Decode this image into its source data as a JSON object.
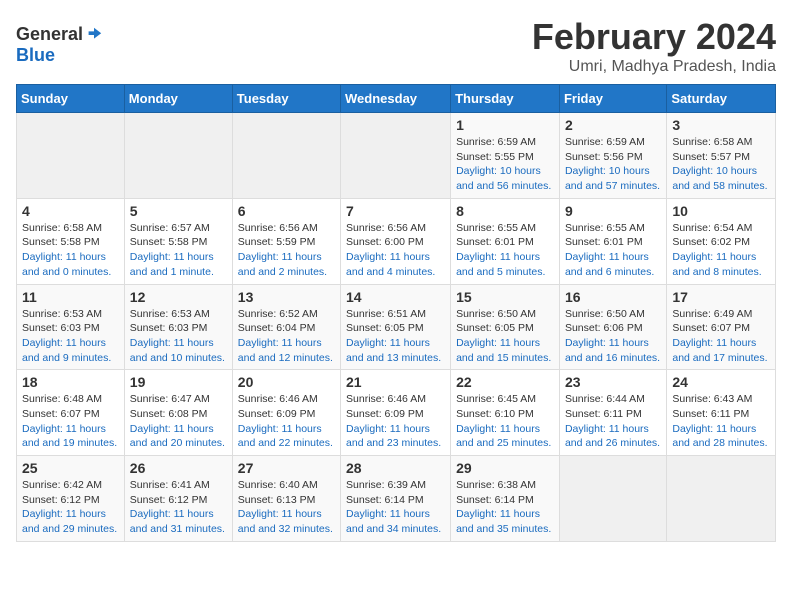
{
  "logo": {
    "general": "General",
    "blue": "Blue"
  },
  "title": "February 2024",
  "location": "Umri, Madhya Pradesh, India",
  "headers": [
    "Sunday",
    "Monday",
    "Tuesday",
    "Wednesday",
    "Thursday",
    "Friday",
    "Saturday"
  ],
  "weeks": [
    [
      {
        "day": "",
        "sunrise": "",
        "sunset": "",
        "daylight": ""
      },
      {
        "day": "",
        "sunrise": "",
        "sunset": "",
        "daylight": ""
      },
      {
        "day": "",
        "sunrise": "",
        "sunset": "",
        "daylight": ""
      },
      {
        "day": "",
        "sunrise": "",
        "sunset": "",
        "daylight": ""
      },
      {
        "day": "1",
        "sunrise": "Sunrise: 6:59 AM",
        "sunset": "Sunset: 5:55 PM",
        "daylight": "Daylight: 10 hours and 56 minutes."
      },
      {
        "day": "2",
        "sunrise": "Sunrise: 6:59 AM",
        "sunset": "Sunset: 5:56 PM",
        "daylight": "Daylight: 10 hours and 57 minutes."
      },
      {
        "day": "3",
        "sunrise": "Sunrise: 6:58 AM",
        "sunset": "Sunset: 5:57 PM",
        "daylight": "Daylight: 10 hours and 58 minutes."
      }
    ],
    [
      {
        "day": "4",
        "sunrise": "Sunrise: 6:58 AM",
        "sunset": "Sunset: 5:58 PM",
        "daylight": "Daylight: 11 hours and 0 minutes."
      },
      {
        "day": "5",
        "sunrise": "Sunrise: 6:57 AM",
        "sunset": "Sunset: 5:58 PM",
        "daylight": "Daylight: 11 hours and 1 minute."
      },
      {
        "day": "6",
        "sunrise": "Sunrise: 6:56 AM",
        "sunset": "Sunset: 5:59 PM",
        "daylight": "Daylight: 11 hours and 2 minutes."
      },
      {
        "day": "7",
        "sunrise": "Sunrise: 6:56 AM",
        "sunset": "Sunset: 6:00 PM",
        "daylight": "Daylight: 11 hours and 4 minutes."
      },
      {
        "day": "8",
        "sunrise": "Sunrise: 6:55 AM",
        "sunset": "Sunset: 6:01 PM",
        "daylight": "Daylight: 11 hours and 5 minutes."
      },
      {
        "day": "9",
        "sunrise": "Sunrise: 6:55 AM",
        "sunset": "Sunset: 6:01 PM",
        "daylight": "Daylight: 11 hours and 6 minutes."
      },
      {
        "day": "10",
        "sunrise": "Sunrise: 6:54 AM",
        "sunset": "Sunset: 6:02 PM",
        "daylight": "Daylight: 11 hours and 8 minutes."
      }
    ],
    [
      {
        "day": "11",
        "sunrise": "Sunrise: 6:53 AM",
        "sunset": "Sunset: 6:03 PM",
        "daylight": "Daylight: 11 hours and 9 minutes."
      },
      {
        "day": "12",
        "sunrise": "Sunrise: 6:53 AM",
        "sunset": "Sunset: 6:03 PM",
        "daylight": "Daylight: 11 hours and 10 minutes."
      },
      {
        "day": "13",
        "sunrise": "Sunrise: 6:52 AM",
        "sunset": "Sunset: 6:04 PM",
        "daylight": "Daylight: 11 hours and 12 minutes."
      },
      {
        "day": "14",
        "sunrise": "Sunrise: 6:51 AM",
        "sunset": "Sunset: 6:05 PM",
        "daylight": "Daylight: 11 hours and 13 minutes."
      },
      {
        "day": "15",
        "sunrise": "Sunrise: 6:50 AM",
        "sunset": "Sunset: 6:05 PM",
        "daylight": "Daylight: 11 hours and 15 minutes."
      },
      {
        "day": "16",
        "sunrise": "Sunrise: 6:50 AM",
        "sunset": "Sunset: 6:06 PM",
        "daylight": "Daylight: 11 hours and 16 minutes."
      },
      {
        "day": "17",
        "sunrise": "Sunrise: 6:49 AM",
        "sunset": "Sunset: 6:07 PM",
        "daylight": "Daylight: 11 hours and 17 minutes."
      }
    ],
    [
      {
        "day": "18",
        "sunrise": "Sunrise: 6:48 AM",
        "sunset": "Sunset: 6:07 PM",
        "daylight": "Daylight: 11 hours and 19 minutes."
      },
      {
        "day": "19",
        "sunrise": "Sunrise: 6:47 AM",
        "sunset": "Sunset: 6:08 PM",
        "daylight": "Daylight: 11 hours and 20 minutes."
      },
      {
        "day": "20",
        "sunrise": "Sunrise: 6:46 AM",
        "sunset": "Sunset: 6:09 PM",
        "daylight": "Daylight: 11 hours and 22 minutes."
      },
      {
        "day": "21",
        "sunrise": "Sunrise: 6:46 AM",
        "sunset": "Sunset: 6:09 PM",
        "daylight": "Daylight: 11 hours and 23 minutes."
      },
      {
        "day": "22",
        "sunrise": "Sunrise: 6:45 AM",
        "sunset": "Sunset: 6:10 PM",
        "daylight": "Daylight: 11 hours and 25 minutes."
      },
      {
        "day": "23",
        "sunrise": "Sunrise: 6:44 AM",
        "sunset": "Sunset: 6:11 PM",
        "daylight": "Daylight: 11 hours and 26 minutes."
      },
      {
        "day": "24",
        "sunrise": "Sunrise: 6:43 AM",
        "sunset": "Sunset: 6:11 PM",
        "daylight": "Daylight: 11 hours and 28 minutes."
      }
    ],
    [
      {
        "day": "25",
        "sunrise": "Sunrise: 6:42 AM",
        "sunset": "Sunset: 6:12 PM",
        "daylight": "Daylight: 11 hours and 29 minutes."
      },
      {
        "day": "26",
        "sunrise": "Sunrise: 6:41 AM",
        "sunset": "Sunset: 6:12 PM",
        "daylight": "Daylight: 11 hours and 31 minutes."
      },
      {
        "day": "27",
        "sunrise": "Sunrise: 6:40 AM",
        "sunset": "Sunset: 6:13 PM",
        "daylight": "Daylight: 11 hours and 32 minutes."
      },
      {
        "day": "28",
        "sunrise": "Sunrise: 6:39 AM",
        "sunset": "Sunset: 6:14 PM",
        "daylight": "Daylight: 11 hours and 34 minutes."
      },
      {
        "day": "29",
        "sunrise": "Sunrise: 6:38 AM",
        "sunset": "Sunset: 6:14 PM",
        "daylight": "Daylight: 11 hours and 35 minutes."
      },
      {
        "day": "",
        "sunrise": "",
        "sunset": "",
        "daylight": ""
      },
      {
        "day": "",
        "sunrise": "",
        "sunset": "",
        "daylight": ""
      }
    ]
  ]
}
